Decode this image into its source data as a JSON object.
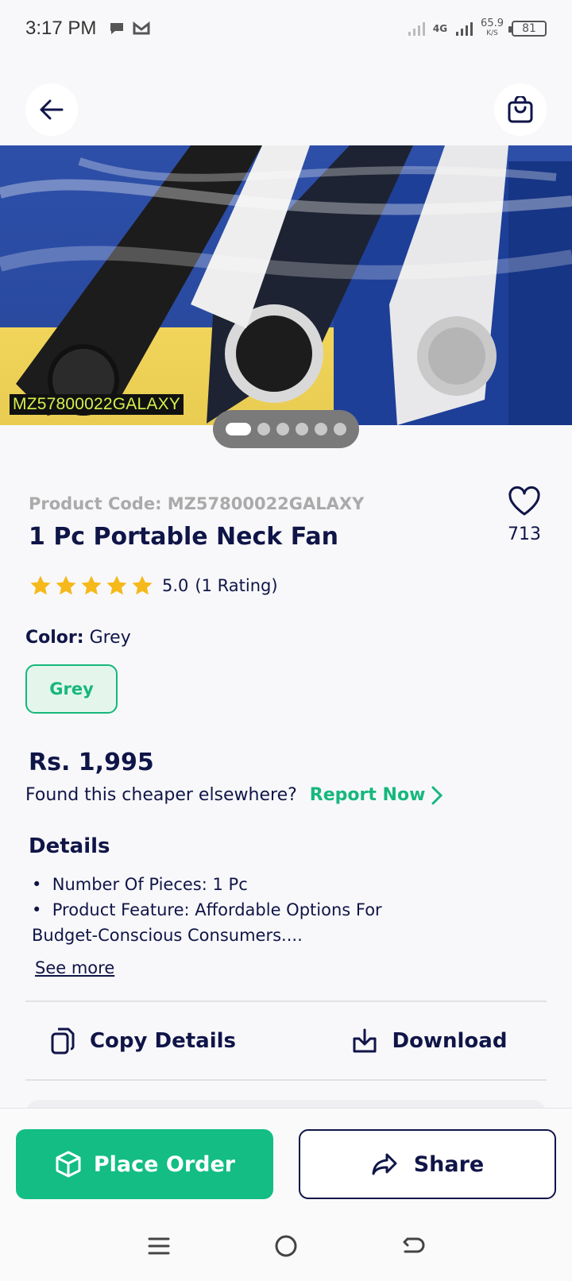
{
  "status_bar": {
    "time": "3:17 PM",
    "network": "4G",
    "speed": "65.9",
    "speed_unit": "K/S",
    "battery": "81",
    "icons": [
      "chat-bubble-icon",
      "mail-icon",
      "signal-icon",
      "battery-icon"
    ]
  },
  "top_bar": {
    "back_icon": "arrow-left-icon",
    "cart_icon": "shopping-bag-icon"
  },
  "hero": {
    "image_caption": "MZ57800022GALAXY",
    "pager_total": 6,
    "pager_active": 0
  },
  "product": {
    "code_label": "Product Code: MZ57800022GALAXY",
    "title": "1 Pc Portable Neck Fan",
    "wishlist_count": "713",
    "rating_value": "5.0",
    "rating_count": "(1 Rating)",
    "stars": 5,
    "color_label": "Color:",
    "color_value": "Grey",
    "color_options": [
      "Grey"
    ],
    "price": "Rs. 1,995",
    "cheaper_text": "Found this cheaper elsewhere?",
    "report_label": "Report Now"
  },
  "details": {
    "heading": "Details",
    "items": [
      "Number Of Pieces: 1 Pc",
      "Product Feature: Affordable Options For Budget-Conscious Consumers...."
    ],
    "see_more": "See more"
  },
  "actions": {
    "copy_label": "Copy Details",
    "download_label": "Download"
  },
  "bottom": {
    "place_order_label": "Place Order",
    "share_label": "Share"
  },
  "colors": {
    "primary_green": "#13bd83",
    "navy": "#101548",
    "star": "#f5b91c"
  }
}
